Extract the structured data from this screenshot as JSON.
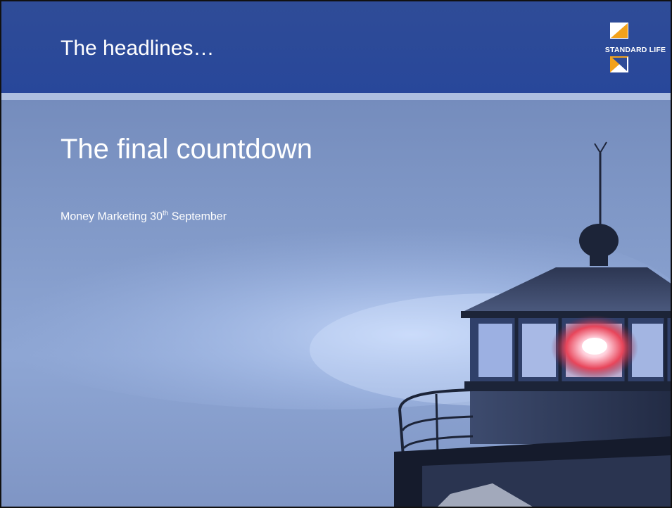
{
  "header": {
    "title": "The headlines…",
    "logo_text": "STANDARD LIFE"
  },
  "main": {
    "title": "The final countdown",
    "subtitle_prefix": "Money Marketing 30",
    "subtitle_sup": "th",
    "subtitle_suffix": " September"
  },
  "colors": {
    "header_blue": "#2f4c97",
    "logo_orange": "#f3a21b",
    "sky_blue": "#7f97c6",
    "lighthouse_dark": "#1c2438",
    "lamp_red": "#e8455a"
  }
}
